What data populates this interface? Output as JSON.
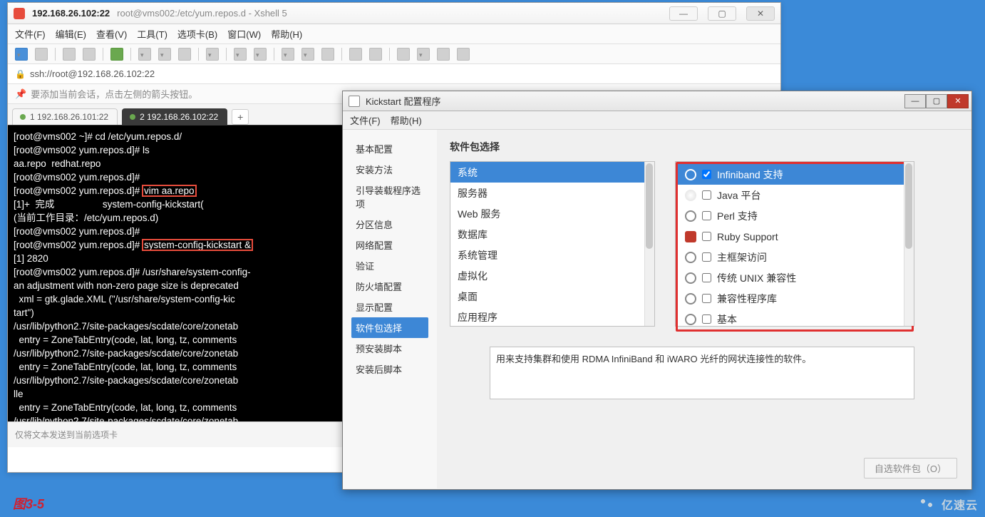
{
  "xshell": {
    "title_ip": "192.168.26.102:22",
    "title_rest": "root@vms002:/etc/yum.repos.d - Xshell 5",
    "menubar": [
      "文件(F)",
      "编辑(E)",
      "查看(V)",
      "工具(T)",
      "选项卡(B)",
      "窗口(W)",
      "帮助(H)"
    ],
    "address": "ssh://root@192.168.26.102:22",
    "hint": "要添加当前会话，点击左侧的箭头按钮。",
    "tabs": [
      {
        "label": "1 192.168.26.101:22",
        "active": false
      },
      {
        "label": "2 192.168.26.102:22",
        "active": true
      }
    ],
    "terminal_lines": [
      "[root@vms002 ~]# cd /etc/yum.repos.d/",
      "[root@vms002 yum.repos.d]# ls",
      "aa.repo  redhat.repo",
      "[root@vms002 yum.repos.d]#",
      {
        "pre": "[root@vms002 yum.repos.d]# ",
        "hl": "vim aa.repo"
      },
      "[1]+  完成                  system-config-kickstart(",
      "(当前工作目录：/etc/yum.repos.d)",
      "[root@vms002 yum.repos.d]#",
      {
        "pre": "[root@vms002 yum.repos.d]# ",
        "hl": "system-config-kickstart &"
      },
      "[1] 2820",
      "[root@vms002 yum.repos.d]# /usr/share/system-config-",
      "an adjustment with non-zero page size is deprecated",
      "  xml = gtk.glade.XML (\"/usr/share/system-config-kic",
      "tart\")",
      "/usr/lib/python2.7/site-packages/scdate/core/zonetab",
      "  entry = ZoneTabEntry(code, lat, long, tz, comments",
      "/usr/lib/python2.7/site-packages/scdate/core/zonetab",
      "  entry = ZoneTabEntry(code, lat, long, tz, comments",
      "/usr/lib/python2.7/site-packages/scdate/core/zonetab",
      "lle",
      "  entry = ZoneTabEntry(code, lat, long, tz, comments",
      "/usr/lib/python2.7/site-packages/scdate/core/zonetab"
    ],
    "footer": "仅将文本发送到当前选项卡"
  },
  "kickstart": {
    "title": "Kickstart 配置程序",
    "menubar": [
      "文件(F)",
      "帮助(H)"
    ],
    "sidebar": [
      "基本配置",
      "安装方法",
      "引导装载程序选项",
      "分区信息",
      "网络配置",
      "验证",
      "防火墙配置",
      "显示配置",
      "软件包选择",
      "预安装脚本",
      "安装后脚本"
    ],
    "sidebar_selected": 8,
    "heading": "软件包选择",
    "categories": [
      "系统",
      "服务器",
      "Web 服务",
      "数据库",
      "系统管理",
      "虚拟化",
      "桌面",
      "应用程序"
    ],
    "category_selected": 0,
    "packages": [
      {
        "label": "Infiniband 支持",
        "selected": true,
        "checked": true,
        "icon": "gear"
      },
      {
        "label": "Java 平台",
        "selected": false,
        "checked": false,
        "icon": "java"
      },
      {
        "label": "Perl 支持",
        "selected": false,
        "checked": false,
        "icon": "gear"
      },
      {
        "label": "Ruby Support",
        "selected": false,
        "checked": false,
        "icon": "ruby"
      },
      {
        "label": "主框架访问",
        "selected": false,
        "checked": false,
        "icon": "gear"
      },
      {
        "label": "传统 UNIX 兼容性",
        "selected": false,
        "checked": false,
        "icon": "gear"
      },
      {
        "label": "兼容性程序库",
        "selected": false,
        "checked": false,
        "icon": "gear"
      },
      {
        "label": "基本",
        "selected": false,
        "checked": false,
        "icon": "gear"
      }
    ],
    "description": "用来支持集群和使用 RDMA InfiniBand 和 iWARO 光纤的网状连接性的软件。",
    "optional_btn": "自选软件包（O）"
  },
  "figure_label": "图3-5",
  "watermark": "亿速云"
}
